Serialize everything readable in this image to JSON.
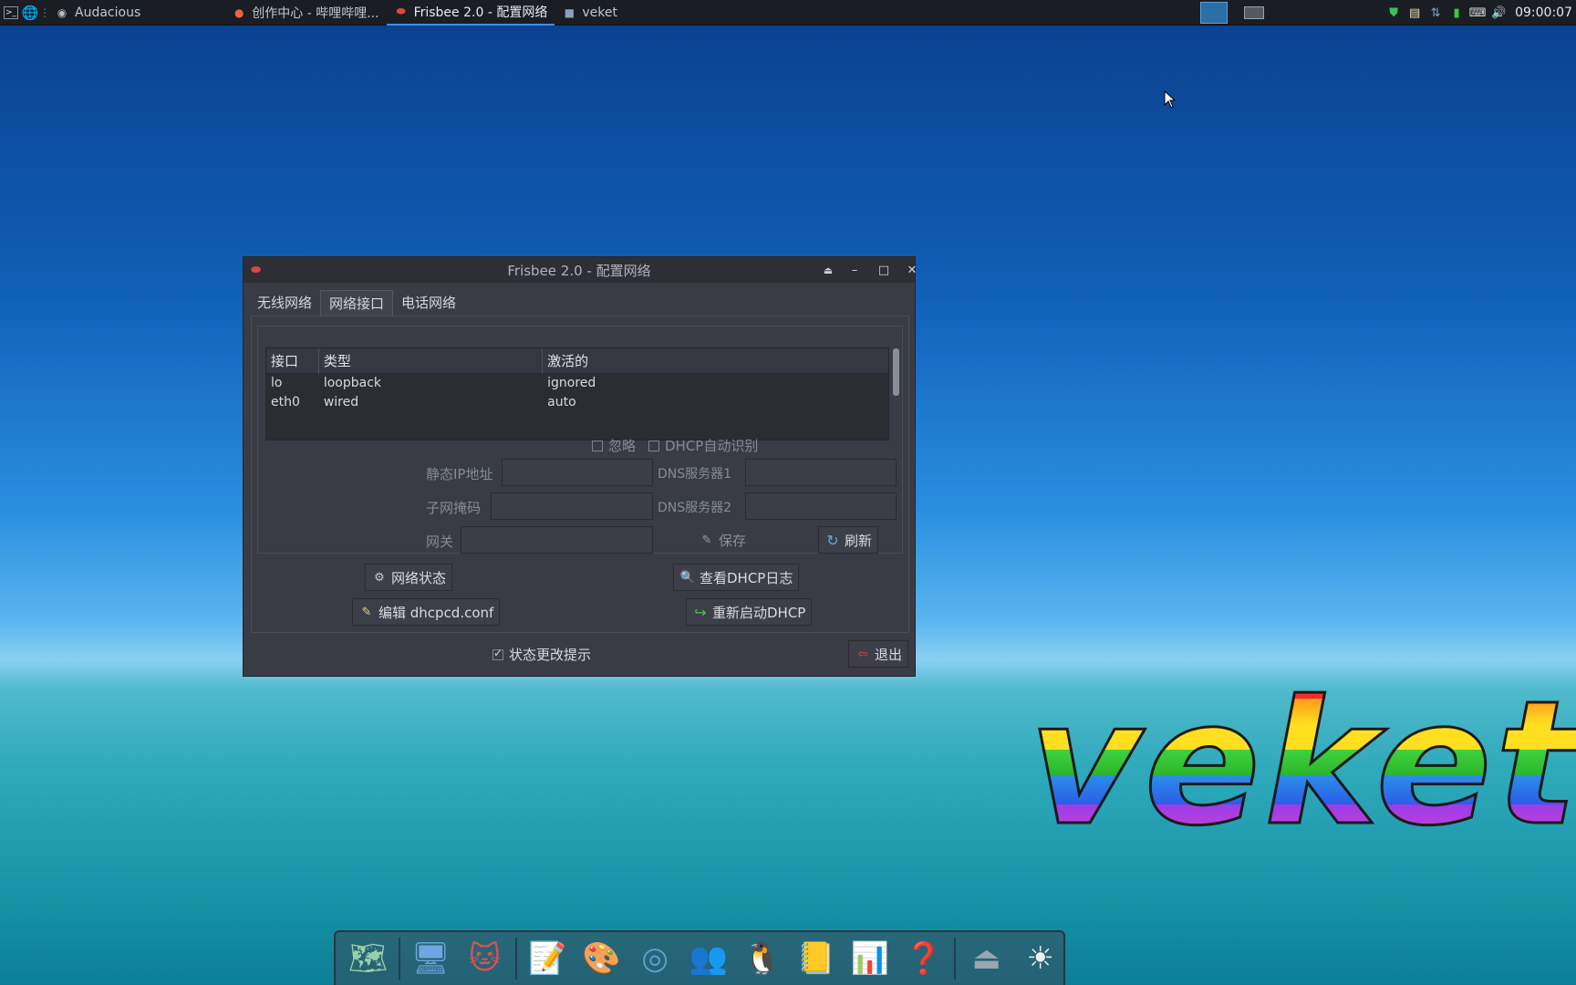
{
  "taskbar": {
    "tasks": [
      {
        "label": "Audacious",
        "icon": "audacious-icon"
      },
      {
        "label": "创作中心 - 哔哩哔哩...",
        "icon": "firefox-icon"
      },
      {
        "label": "Frisbee 2.0 - 配置网络",
        "icon": "frisbee-icon",
        "active": true
      },
      {
        "label": "veket",
        "icon": "folder-icon"
      }
    ],
    "clock": "09:00:07"
  },
  "window": {
    "title": "Frisbee 2.0 - 配置网络",
    "tabs": [
      "无线网络",
      "网络接口",
      "电话网络"
    ],
    "active_tab": 1,
    "table": {
      "headers": [
        "接口",
        "类型",
        "激活的"
      ],
      "rows": [
        [
          "lo",
          "loopback",
          "ignored"
        ],
        [
          "eth0",
          "wired",
          "auto"
        ]
      ]
    },
    "ignore_label": "忽略",
    "dhcp_auto_label": "DHCP自动识别",
    "static_ip_label": "静态IP地址",
    "dns1_label": "DNS服务器1",
    "subnet_label": "子网掩码",
    "dns2_label": "DNS服务器2",
    "gateway_label": "网关",
    "save_label": "保存",
    "refresh_label": "刷新",
    "net_status_label": "网络状态",
    "view_dhcp_log_label": "查看DHCP日志",
    "edit_dhcpcd_label": "编辑 dhcpcd.conf",
    "restart_dhcp_label": "重新启动DHCP",
    "status_change_label": "状态更改提示",
    "exit_label": "退出"
  },
  "desktop": {
    "logo_text": "veket"
  },
  "colors": {
    "accent": "#3d8fe6",
    "window_bg": "#393c44",
    "panel_bg": "#1a1d24"
  }
}
